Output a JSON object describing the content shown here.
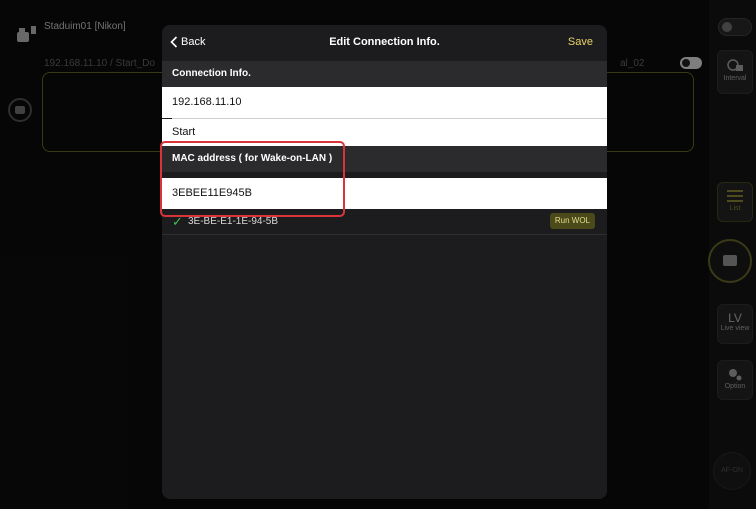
{
  "background": {
    "camera_name": "Staduim01 [Nikon]",
    "connection_label": "192.168.11.10 / Start_Do",
    "right_fragment": "al_02",
    "side": {
      "interval_label": "Interval",
      "list_label": "List",
      "lv_label": "LV",
      "lv_sub": "Live view",
      "option_label": "Option",
      "af_label": "AF-ON"
    }
  },
  "modal": {
    "back_label": "Back",
    "title": "Edit Connection Info.",
    "save_label": "Save",
    "connection_header": "Connection Info.",
    "ip_value": "192.168.11.10",
    "name_value": "Start",
    "mac_header": "MAC address ( for Wake-on-LAN )",
    "mac_value": "3EBEE11E945B",
    "wol_mac": "3E-BE-E1-1E-94-5B",
    "wol_button": "Run WOL"
  },
  "colors": {
    "accent": "#e9d36b",
    "check": "#3fbf4f",
    "highlight": "#d9343a"
  },
  "icons": [
    "chevron-left-icon",
    "check-icon",
    "camera-icon",
    "interval-icon",
    "list-icon",
    "gear-icon"
  ]
}
